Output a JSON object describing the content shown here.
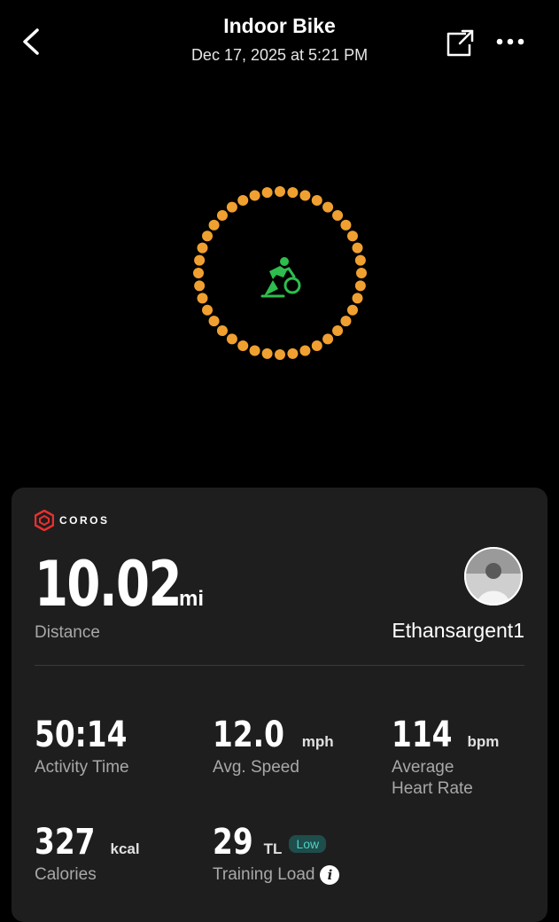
{
  "header": {
    "title": "Indoor Bike",
    "subtitle": "Dec 17, 2025 at 5:21 PM"
  },
  "activity": {
    "icon": "indoor-bike-icon"
  },
  "card": {
    "brand": "COROS",
    "distance": {
      "value": "10.02",
      "unit": "mi",
      "label": "Distance"
    },
    "username": "Ethansargent1",
    "stats": [
      {
        "value": "50:14",
        "unit": "",
        "label": "Activity Time"
      },
      {
        "value": "12.0",
        "unit": "mph",
        "label": "Avg. Speed"
      },
      {
        "value": "114",
        "unit": "bpm",
        "label": "Average\nHeart Rate"
      },
      {
        "value": "327",
        "unit": "kcal",
        "label": "Calories"
      },
      {
        "value": "29",
        "unit": "TL",
        "label": "Training Load",
        "badge": "Low"
      }
    ]
  },
  "colors": {
    "ring": "#f0a030",
    "icon": "#2ebd4e",
    "badge_bg": "#1e4d4b",
    "badge_text": "#4fd1c5"
  }
}
